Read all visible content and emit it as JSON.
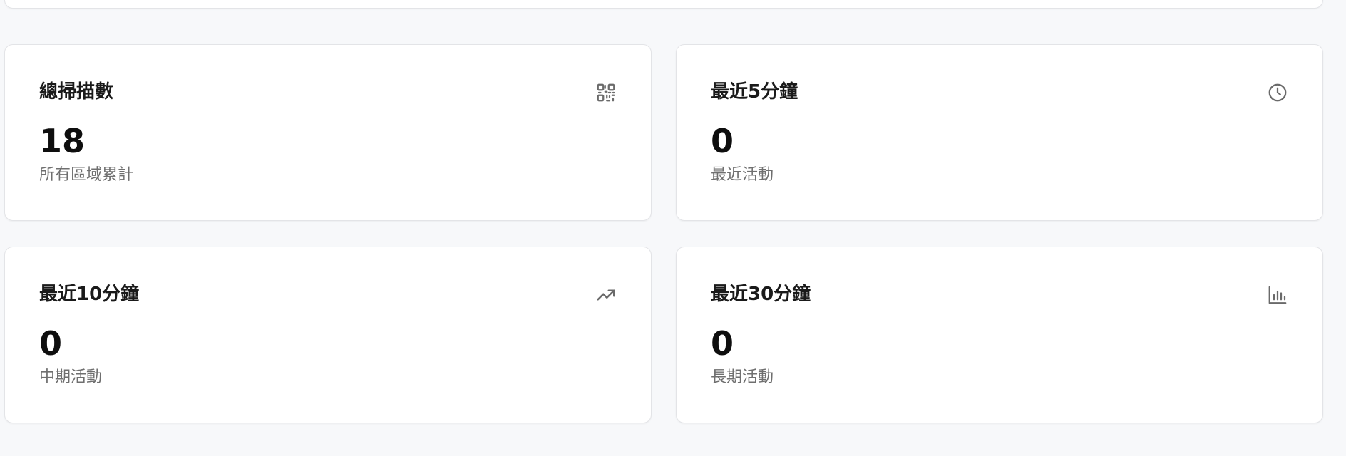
{
  "stats": [
    {
      "title": "總掃描數",
      "value": "18",
      "caption": "所有區域累計",
      "icon": "qr-code-icon"
    },
    {
      "title": "最近5分鐘",
      "value": "0",
      "caption": "最近活動",
      "icon": "clock-icon"
    },
    {
      "title": "最近10分鐘",
      "value": "0",
      "caption": "中期活動",
      "icon": "trending-up-icon"
    },
    {
      "title": "最近30分鐘",
      "value": "0",
      "caption": "長期活動",
      "icon": "bar-chart-icon"
    }
  ],
  "colors": {
    "background": "#f7f8fa",
    "card": "#ffffff",
    "border": "#e3e4e7",
    "icon": "#6a6a6a",
    "caption": "#6f6f6f"
  }
}
